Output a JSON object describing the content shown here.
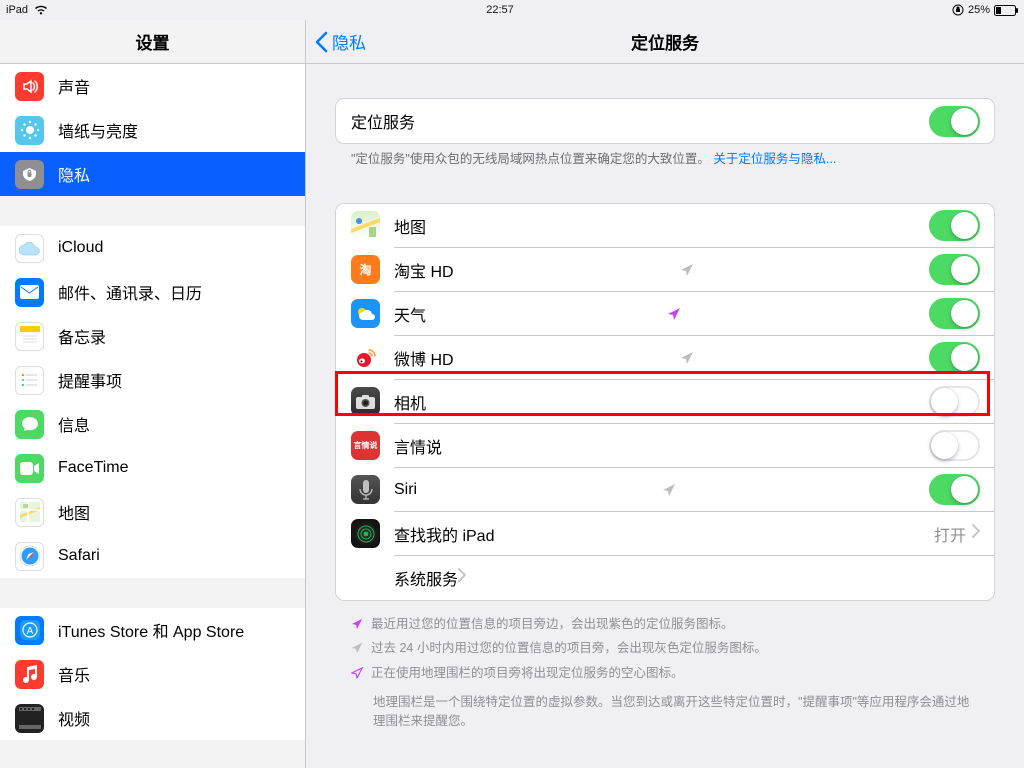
{
  "statusbar": {
    "device": "iPad",
    "time": "22:57",
    "battery": "25%"
  },
  "sidebar": {
    "title": "设置",
    "group1": [
      {
        "label": "声音",
        "color": "#ff3b30",
        "icon": "sound"
      },
      {
        "label": "墙纸与亮度",
        "color": "#55c7ec",
        "icon": "wallpaper"
      },
      {
        "label": "隐私",
        "color": "#8e8e93",
        "icon": "privacy",
        "selected": true
      }
    ],
    "group2": [
      {
        "label": "iCloud",
        "color": "#fff",
        "icon": "icloud"
      },
      {
        "label": "邮件、通讯录、日历",
        "color": "#007aff",
        "icon": "mail"
      },
      {
        "label": "备忘录",
        "color": "#fff",
        "icon": "notes"
      },
      {
        "label": "提醒事项",
        "color": "#fff",
        "icon": "reminders"
      },
      {
        "label": "信息",
        "color": "#4cd964",
        "icon": "messages"
      },
      {
        "label": "FaceTime",
        "color": "#4cd964",
        "icon": "facetime"
      },
      {
        "label": "地图",
        "color": "#fff",
        "icon": "maps"
      },
      {
        "label": "Safari",
        "color": "#fff",
        "icon": "safari"
      }
    ],
    "group3": [
      {
        "label": "iTunes Store 和 App Store",
        "color": "#007aff",
        "icon": "appstore"
      },
      {
        "label": "音乐",
        "color": "#ff3b30",
        "icon": "music"
      },
      {
        "label": "视频",
        "color": "#222",
        "icon": "video"
      }
    ]
  },
  "detail": {
    "back": "隐私",
    "title": "定位服务",
    "master_label": "定位服务",
    "master_on": true,
    "master_foot_text": "\"定位服务\"使用众包的无线局域网热点位置来确定您的大致位置。",
    "master_foot_link": "关于定位服务与隐私...",
    "apps": [
      {
        "label": "地图",
        "on": true,
        "arrow": "none",
        "icon": "maps-app"
      },
      {
        "label": "淘宝 HD",
        "on": true,
        "arrow": "gray",
        "icon": "taobao"
      },
      {
        "label": "天气",
        "on": true,
        "arrow": "purple",
        "icon": "weather",
        "highlight": true
      },
      {
        "label": "微博 HD",
        "on": true,
        "arrow": "gray",
        "icon": "weibo"
      },
      {
        "label": "相机",
        "on": false,
        "arrow": "none",
        "icon": "camera"
      },
      {
        "label": "言情说",
        "on": false,
        "arrow": "none",
        "icon": "yanqing"
      },
      {
        "label": "Siri",
        "on": true,
        "arrow": "gray",
        "icon": "siri"
      },
      {
        "label": "查找我的 iPad",
        "link": true,
        "value": "打开",
        "icon": "findmy"
      },
      {
        "label": "系统服务",
        "link": true,
        "icon": "none"
      }
    ],
    "hints": [
      {
        "color": "#c644fc",
        "text": "最近用过您的位置信息的项目旁边，会出现紫色的定位服务图标。"
      },
      {
        "color": "#bcbcbc",
        "text": "过去 24 小时内用过您的位置信息的项目旁，会出现灰色定位服务图标。"
      },
      {
        "color": "#c644fc",
        "outline": true,
        "text": "正在使用地理围栏的项目旁将出现定位服务的空心图标。"
      }
    ],
    "hint_block": "地理围栏是一个围绕特定位置的虚拟参数。当您到达或离开这些特定位置时，\"提醒事项\"等应用程序会通过地理围栏来提醒您。"
  }
}
